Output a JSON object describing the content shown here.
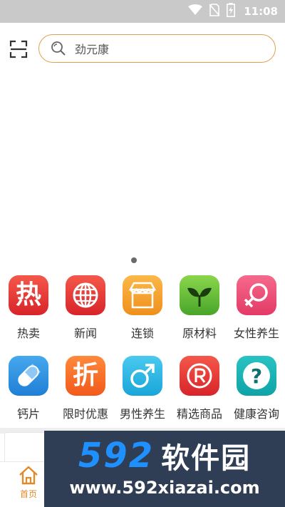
{
  "status_bar": {
    "time": "11:08",
    "icons": [
      "wifi-icon",
      "no-sim-icon",
      "battery-charging-icon"
    ],
    "background": "#c9c9c9"
  },
  "search": {
    "scan_icon": "scan-icon",
    "search_icon": "search-icon",
    "placeholder": "劲元康",
    "border_color": "#e0a050"
  },
  "banner": {
    "page_indicator_count": 1
  },
  "categories": {
    "row1": [
      {
        "label": "热卖",
        "icon": "hot-icon",
        "glyph": "热",
        "color": "#e33a2e"
      },
      {
        "label": "新闻",
        "icon": "globe-icon",
        "glyph": "",
        "color": "#e33a2e"
      },
      {
        "label": "连锁",
        "icon": "store-icon",
        "glyph": "",
        "color": "#f6a52e"
      },
      {
        "label": "原材料",
        "icon": "sprout-icon",
        "glyph": "",
        "color": "#5fb93a"
      },
      {
        "label": "女性养生",
        "icon": "female-icon",
        "glyph": "",
        "color": "#ec5078"
      }
    ],
    "row2": [
      {
        "label": "钙片",
        "icon": "capsule-icon",
        "glyph": "",
        "color": "#2f90e0"
      },
      {
        "label": "限时优惠",
        "icon": "discount-icon",
        "glyph": "折",
        "color": "#f6702a"
      },
      {
        "label": "男性养生",
        "icon": "male-icon",
        "glyph": "",
        "color": "#2aa8e0"
      },
      {
        "label": "精选商品",
        "icon": "registered-icon",
        "glyph": "",
        "color": "#e33a2e"
      },
      {
        "label": "健康咨询",
        "icon": "question-icon",
        "glyph": "?",
        "color": "#1aadb0"
      }
    ]
  },
  "tabbar": {
    "home_label": "首页",
    "home_icon": "home-icon",
    "accent": "#e08a2a"
  },
  "watermark": {
    "number": "592",
    "name": "软件园",
    "url": "www.592xiazai.com"
  }
}
